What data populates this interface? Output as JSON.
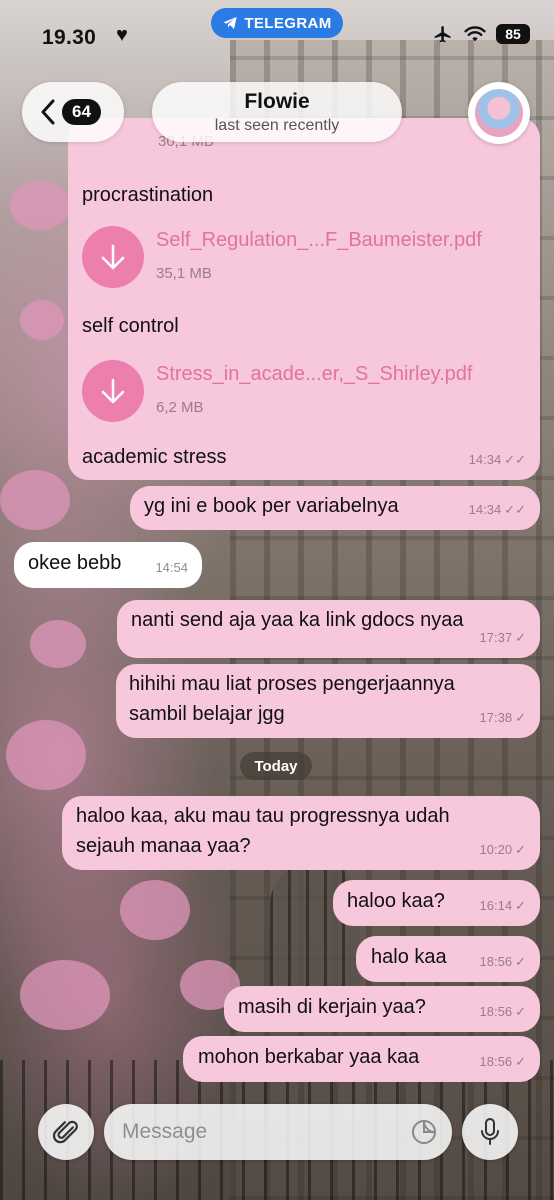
{
  "status_bar": {
    "time": "19.30",
    "app_pill": "TELEGRAM",
    "battery": "85"
  },
  "header": {
    "back_count": "64",
    "title": "Flowie",
    "subtitle": "last seen recently"
  },
  "file_bubble": {
    "partial_size": "30,1 MB",
    "caption_1": "procrastination",
    "file_1": {
      "name": "Self_Regulation_...F_Baumeister.pdf",
      "size": "35,1 MB"
    },
    "caption_2": "self control",
    "file_2": {
      "name": "Stress_in_acade...er,_S_Shirley.pdf",
      "size": "6,2 MB"
    },
    "caption_3": "academic stress",
    "time": "14:34"
  },
  "messages": [
    {
      "text": "yg ini e book per variabelnya",
      "time": "14:34",
      "dir": "out",
      "read": true
    },
    {
      "text": "okee bebb",
      "time": "14:54",
      "dir": "in"
    },
    {
      "text": "nanti send aja yaa ka link gdocs nyaa",
      "time": "17:37",
      "dir": "out",
      "read": false
    },
    {
      "line1": "hihihi mau liat proses pengerjaannya",
      "line2": "sambil belajar jgg",
      "time": "17:38",
      "dir": "out",
      "read": false
    },
    {
      "line1": "haloo kaa, aku mau tau progressnya udah",
      "line2": "sejauh manaa yaa?",
      "time": "10:20",
      "dir": "out",
      "read": false
    },
    {
      "text": "haloo kaa?",
      "time": "16:14",
      "dir": "out",
      "read": false
    },
    {
      "text": "halo kaa",
      "time": "18:56",
      "dir": "out",
      "read": false
    },
    {
      "text": "masih di kerjain yaa?",
      "time": "18:56",
      "dir": "out",
      "read": false
    },
    {
      "text": "mohon berkabar yaa kaa",
      "time": "18:56",
      "dir": "out",
      "read": false
    }
  ],
  "date_separator": "Today",
  "composer": {
    "placeholder": "Message"
  },
  "colors": {
    "outgoing_bubble": "#f7c7dc",
    "incoming_bubble": "#ffffff",
    "file_icon": "#ec7fad",
    "file_name": "#e073a2",
    "telegram_blue": "#2a7be3"
  }
}
